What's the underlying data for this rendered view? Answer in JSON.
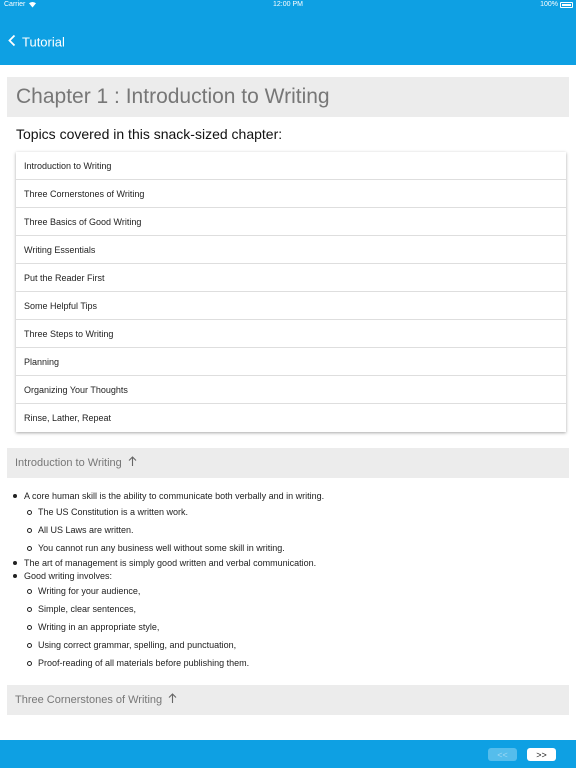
{
  "status_bar": {
    "carrier": "Carrier",
    "wifi_icon": "wifi-icon",
    "time": "12:00 PM",
    "battery": "100%"
  },
  "nav": {
    "back_label": "Tutorial",
    "back_icon": "chevron-left-icon"
  },
  "chapter": {
    "title": "Chapter 1 : Introduction to Writing",
    "topics_intro": "Topics covered in this snack-sized chapter:",
    "topics": [
      "Introduction to Writing",
      "Three Cornerstones of Writing",
      "Three Basics of Good Writing",
      "Writing Essentials",
      "Put the Reader First",
      "Some Helpful Tips",
      "Three Steps to Writing",
      "Planning",
      "Organizing Your Thoughts",
      "Rinse, Lather, Repeat"
    ]
  },
  "sections": [
    {
      "title": "Introduction to Writing",
      "bullets": [
        "A core human skill is the ability to communicate both verbally and in writing.",
        "The US Constitution is a written work.",
        "All US Laws are written.",
        "You cannot run any business well without some skill in writing.",
        "The art of management is simply good written and verbal communication.",
        "Good writing involves:",
        "Writing for your audience,",
        "Simple, clear sentences,",
        "Writing in an appropriate style,",
        "Using correct grammar, spelling, and punctuation,",
        "Proof-reading of all materials before publishing them."
      ]
    },
    {
      "title": "Three Cornerstones of Writing"
    }
  ],
  "pager": {
    "prev_label": "<<",
    "next_label": ">>"
  },
  "colors": {
    "accent": "#0ea0e3",
    "header_bg": "#ececec",
    "header_text": "#777777"
  }
}
